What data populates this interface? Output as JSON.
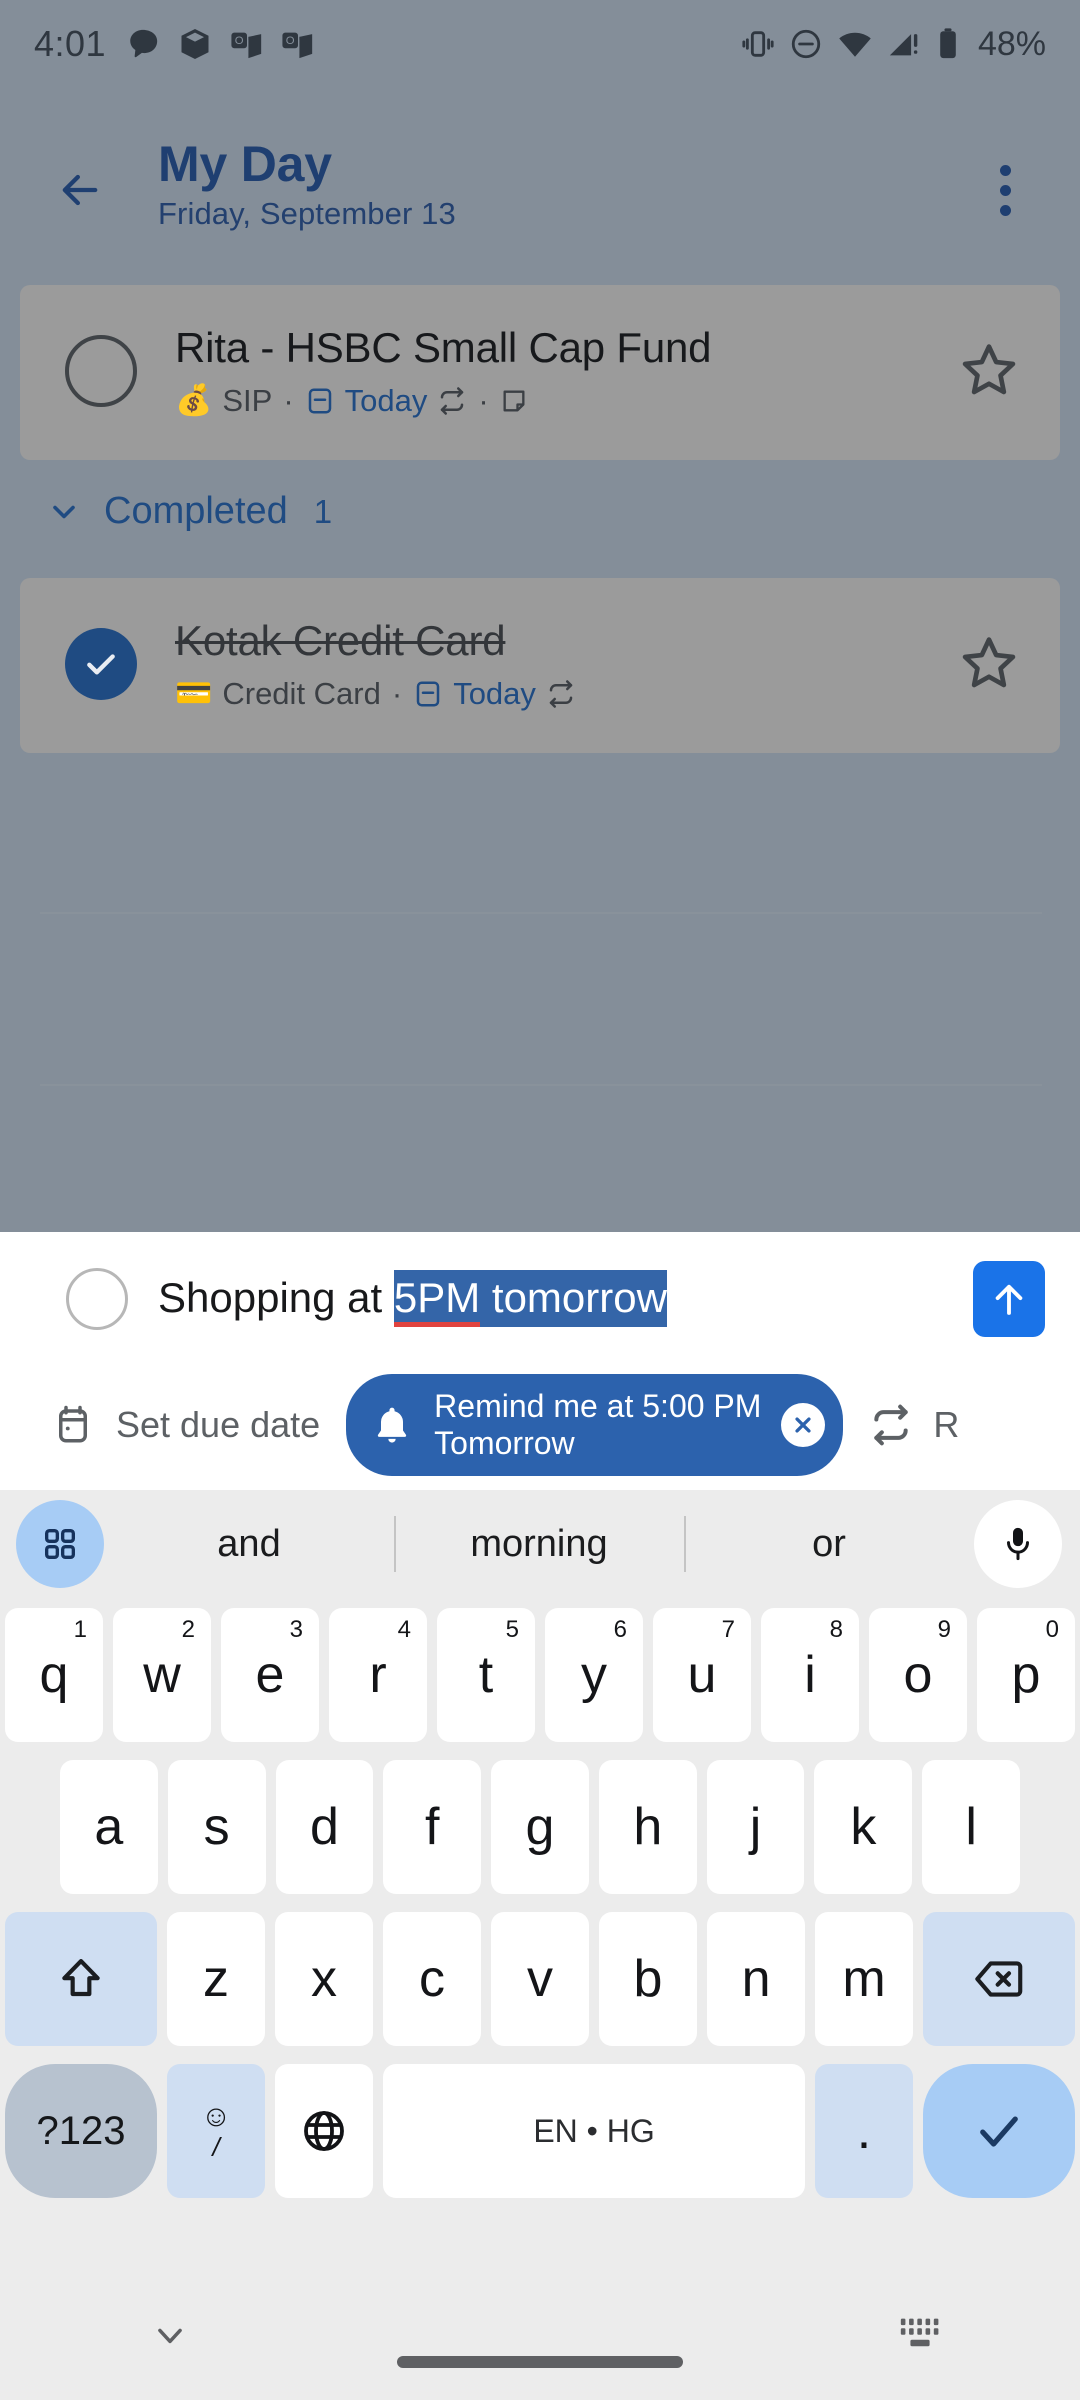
{
  "status_bar": {
    "clock": "4:01",
    "battery_percent": "48%",
    "left_icons": [
      "chat-bubble-icon",
      "package-box-icon",
      "outlook-icon",
      "outlook-icon"
    ],
    "right_icons": [
      "vibrate-icon",
      "do-not-disturb-icon",
      "wifi-icon",
      "cellular-signal-icon",
      "battery-icon"
    ]
  },
  "header": {
    "title": "My Day",
    "subtitle": "Friday, September 13",
    "back_label": "Back",
    "more_label": "More options"
  },
  "tasks": [
    {
      "title": "Rita - HSBC Small Cap Fund",
      "completed": false,
      "emoji": "💰",
      "list_name": "SIP",
      "due": "Today",
      "has_repeat": true,
      "has_note": true,
      "starred": false
    }
  ],
  "completed_section": {
    "label": "Completed",
    "count": "1",
    "expanded": true,
    "tasks": [
      {
        "title": "Kotak Credit Card",
        "completed": true,
        "emoji": "💳",
        "list_name": "Credit Card",
        "due": "Today",
        "has_repeat": true,
        "has_note": false,
        "starred": false
      }
    ]
  },
  "composer": {
    "text_prefix": "Shopping at ",
    "text_selected_misspelled": "5PM",
    "text_selected_rest": " tomorrow",
    "full_text": "Shopping at 5PM tomorrow",
    "send_label": "Add task",
    "chips": {
      "due_date_label": "Set due date",
      "reminder_line1": "Remind me at 5:00 PM",
      "reminder_line2": "Tomorrow",
      "reminder_dismiss_label": "Remove reminder",
      "repeat_label": "R"
    }
  },
  "keyboard": {
    "suggestions": [
      "and",
      "morning",
      "or"
    ],
    "row1": [
      {
        "label": "q",
        "num": "1"
      },
      {
        "label": "w",
        "num": "2"
      },
      {
        "label": "e",
        "num": "3"
      },
      {
        "label": "r",
        "num": "4"
      },
      {
        "label": "t",
        "num": "5"
      },
      {
        "label": "y",
        "num": "6"
      },
      {
        "label": "u",
        "num": "7"
      },
      {
        "label": "i",
        "num": "8"
      },
      {
        "label": "o",
        "num": "9"
      },
      {
        "label": "p",
        "num": "0"
      }
    ],
    "row2": [
      "a",
      "s",
      "d",
      "f",
      "g",
      "h",
      "j",
      "k",
      "l"
    ],
    "row3": [
      "z",
      "x",
      "c",
      "v",
      "b",
      "n",
      "m"
    ],
    "shift_label": "shift-icon",
    "backspace_label": "backspace-icon",
    "symbols_label": "?123",
    "emoji_top": "☺",
    "emoji_bottom": "/",
    "globe_label": "globe-icon",
    "space_label": "EN • HG",
    "period_label": ".",
    "enter_label": "✓"
  },
  "nav_bar": {
    "hide_keyboard_label": "Hide keyboard",
    "home_label": "Home",
    "switch_keyboard_label": "Switch keyboard"
  },
  "colors": {
    "accent_blue": "#1f4b82",
    "chip_blue": "#2c62ad",
    "send_blue": "#1a73e8",
    "scrim_gray": "#848e99",
    "card_gray": "#9b9b9b",
    "selection_blue": "#3465a8",
    "misspell_red": "#e0433f",
    "key_white": "#ffffff",
    "key_mod_blue": "#cfdef2",
    "key_accent_blue": "#a7ccf5"
  }
}
